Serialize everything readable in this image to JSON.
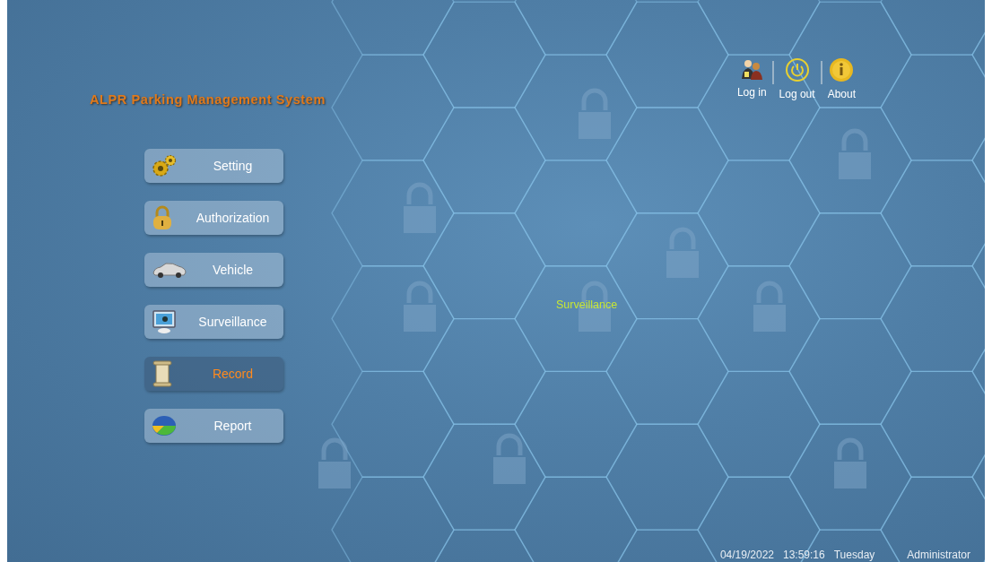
{
  "title": "ALPR Parking Management System",
  "top_actions": [
    {
      "label": "Log in"
    },
    {
      "label": "Log out"
    },
    {
      "label": "About"
    }
  ],
  "menu": [
    {
      "label": "Setting",
      "selected": false
    },
    {
      "label": "Authorization",
      "selected": false
    },
    {
      "label": "Vehicle",
      "selected": false
    },
    {
      "label": "Surveillance",
      "selected": false
    },
    {
      "label": "Record",
      "selected": true
    },
    {
      "label": "Report",
      "selected": false
    }
  ],
  "hover_label": "Surveillance",
  "status_bar": {
    "date": "04/19/2022",
    "time": "13:59:16",
    "weekday": "Tuesday",
    "user": "Administrator"
  }
}
